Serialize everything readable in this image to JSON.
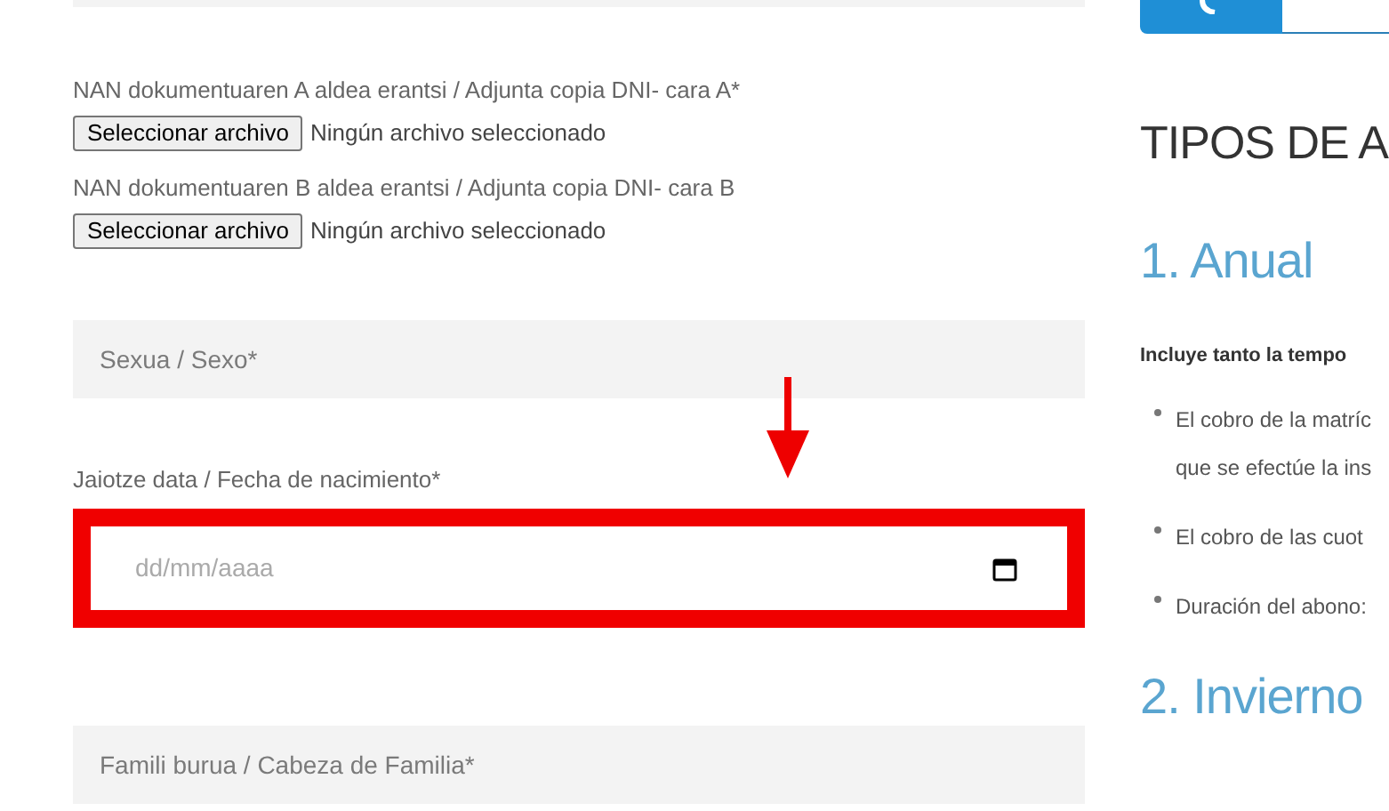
{
  "form": {
    "uploads": [
      {
        "label": "NAN dokumentuaren A aldea erantsi / Adjunta copia DNI- cara A*",
        "button": "Seleccionar archivo",
        "status": "Ningún archivo seleccionado"
      },
      {
        "label": "NAN dokumentuaren B aldea erantsi / Adjunta copia DNI- cara B",
        "button": "Seleccionar archivo",
        "status": "Ningún archivo seleccionado"
      }
    ],
    "sex_field": {
      "placeholder": "Sexua / Sexo*"
    },
    "birth_date": {
      "label": "Jaiotze data / Fecha de nacimiento*",
      "placeholder": "dd/mm/aaaa",
      "highlighted": true
    },
    "family_field": {
      "placeholder": "Famili burua / Cabeza de Familia*"
    }
  },
  "sidebar": {
    "heading": "TIPOS DE A",
    "sections": [
      {
        "title": "1. Anual",
        "intro": "Incluye tanto la tempo",
        "bullets": [
          [
            "El cobro de la matríc",
            "que se efectúe la ins"
          ],
          [
            "El cobro de las cuot"
          ],
          [
            "Duración del abono:"
          ]
        ]
      },
      {
        "title": "2. Invierno"
      }
    ]
  }
}
